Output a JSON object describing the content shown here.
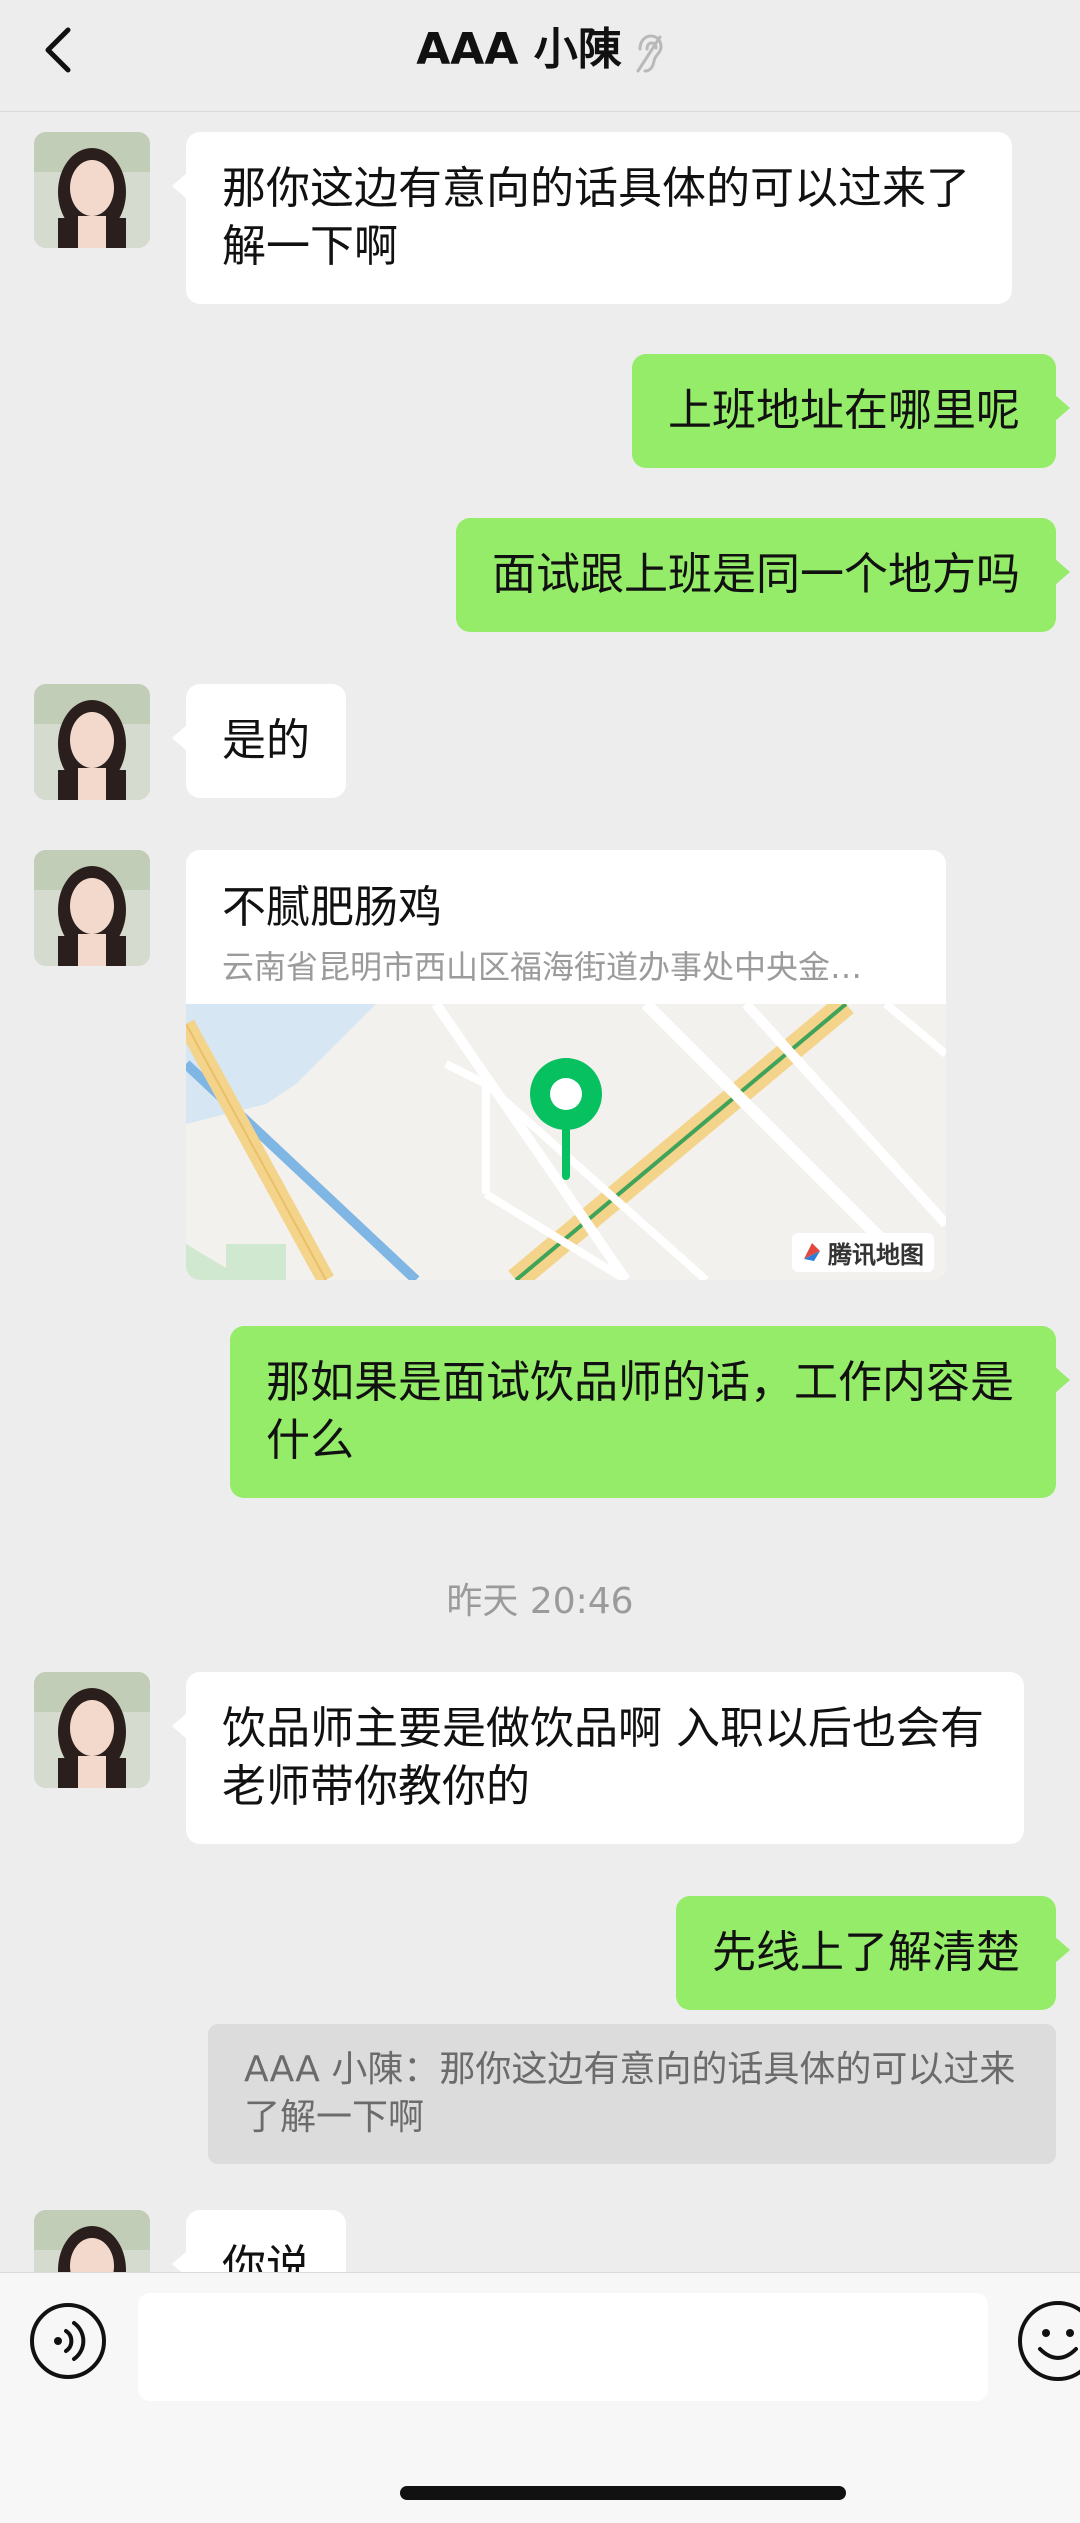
{
  "header": {
    "title": "AAA 小陳",
    "back_icon": "chevron-left-icon",
    "status_icon": "ear-icon"
  },
  "messages": [
    {
      "side": "left",
      "text": "那你这边有意向的话具体的可以过来了解一下啊"
    },
    {
      "side": "right",
      "text": "上班地址在哪里呢"
    },
    {
      "side": "right",
      "text": "面试跟上班是同一个地方吗"
    },
    {
      "side": "left",
      "text": "是的"
    },
    {
      "side": "left",
      "type": "location",
      "name": "不腻肥肠鸡",
      "address": "云南省昆明市西山区福海街道办事处中央金…",
      "map_credit": "腾讯地图"
    },
    {
      "side": "right",
      "text": "那如果是面试饮品师的话，工作内容是什么"
    },
    {
      "type": "time",
      "text": "昨天 20:46"
    },
    {
      "side": "left",
      "text": "饮品师主要是做饮品啊 入职以后也会有老师带你教你的"
    },
    {
      "side": "right",
      "text": "先线上了解清楚"
    },
    {
      "type": "quote",
      "text": "AAA 小陳：那你这边有意向的话具体的可以过来了解一下啊"
    },
    {
      "side": "left",
      "text": "你说"
    }
  ],
  "input_bar": {
    "voice_icon": "voice-icon",
    "emoji_icon": "emoji-icon",
    "value": ""
  },
  "colors": {
    "self_bubble": "#95ec69",
    "other_bubble": "#ffffff",
    "background": "#ededed",
    "pin": "#07c160"
  }
}
